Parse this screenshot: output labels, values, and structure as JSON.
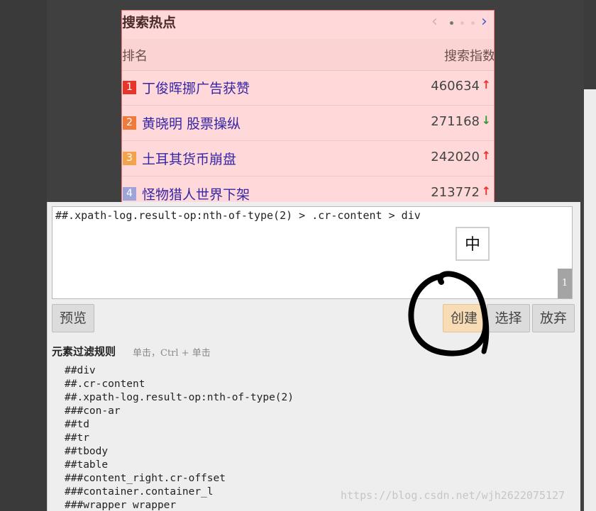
{
  "hot_search": {
    "title": "搜索热点",
    "prev_icon": "chevron-left",
    "next_icon": "chevron-right",
    "page_dots": 3,
    "active_dot": 1,
    "header_rank": "排名",
    "header_index": "搜索指数",
    "rows": [
      {
        "rank": "1",
        "title": "丁俊晖挪广告获赞",
        "count": "460634",
        "trend": "up",
        "rank_color": "#e8352c"
      },
      {
        "rank": "2",
        "title": "黄晓明 股票操纵",
        "count": "271168",
        "trend": "down",
        "rank_color": "#f07a3a"
      },
      {
        "rank": "3",
        "title": "土耳其货币崩盘",
        "count": "242020",
        "trend": "up",
        "rank_color": "#f3a34a"
      },
      {
        "rank": "4",
        "title": "怪物猎人世界下架",
        "count": "213772",
        "trend": "up",
        "rank_color": "#9fa4d8"
      }
    ]
  },
  "editor": {
    "rule_text": "##.xpath-log.result-op:nth-of-type(2) > .cr-content > div",
    "ime_indicator": "中",
    "corner_badge": "1"
  },
  "buttons": {
    "preview": "预览",
    "create": "创建",
    "select": "选择",
    "discard": "放弃"
  },
  "rules": {
    "heading": "元素过滤规则",
    "hint": "单击，Ctrl + 单击",
    "items": [
      "##div",
      "##.cr-content",
      "##.xpath-log.result-op:nth-of-type(2)",
      "###con-ar",
      "##td",
      "##tr",
      "##tbody",
      "##table",
      "###content_right.cr-offset",
      "###container.container_l",
      "###wrapper wrapper"
    ]
  },
  "watermark": "https://blog.csdn.net/wjh2622075127",
  "colors": {
    "trend_up": "#e8352c",
    "trend_down": "#2f9a3a",
    "create_button": "#f8dcb5",
    "hot_bg": "#ffd9d9"
  }
}
